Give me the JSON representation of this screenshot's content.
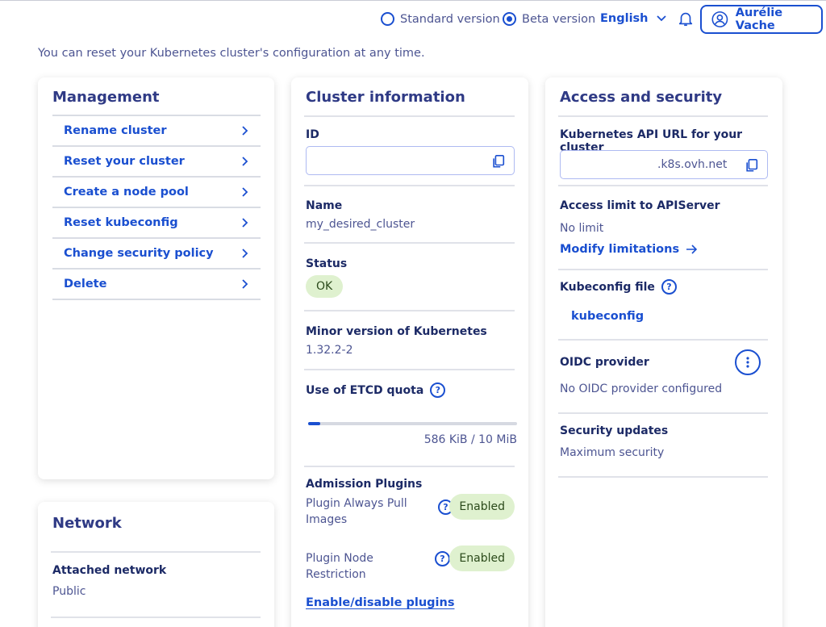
{
  "topbar": {
    "standard_label": "Standard version",
    "beta_label": "Beta version",
    "language": "English",
    "user_name": "Aurélie Vache"
  },
  "intro_text": "You can reset your Kubernetes cluster's configuration at any time.",
  "management": {
    "title": "Management",
    "items": [
      {
        "label": "Rename cluster"
      },
      {
        "label": "Reset your cluster"
      },
      {
        "label": "Create a node pool"
      },
      {
        "label": "Reset kubeconfig"
      },
      {
        "label": "Change security policy"
      },
      {
        "label": "Delete"
      }
    ]
  },
  "network": {
    "title": "Network",
    "attached_label": "Attached network",
    "attached_value": "Public"
  },
  "cluster": {
    "title": "Cluster information",
    "id_label": "ID",
    "id_value": "",
    "name_label": "Name",
    "name_value": "my_desired_cluster",
    "status_label": "Status",
    "status_value": "OK",
    "version_label": "Minor version of Kubernetes",
    "version_value": "1.32.2-2",
    "etcd_label": "Use of ETCD quota",
    "etcd_usage_text": "586 KiB / 10 MiB",
    "etcd_fraction": 0.057,
    "admission_label": "Admission Plugins",
    "plugins": [
      {
        "name_line1": "Plugin Always Pull",
        "name_line2": "Images",
        "status": "Enabled"
      },
      {
        "name_line1": "Plugin Node",
        "name_line2": "Restriction",
        "status": "Enabled"
      }
    ],
    "plugins_link": "Enable/disable plugins"
  },
  "access": {
    "title": "Access and security",
    "api_label": "Kubernetes API URL for your cluster",
    "api_value": ".k8s.ovh.net",
    "limit_label": "Access limit to APIServer",
    "limit_value": "No limit",
    "modify_link": "Modify limitations",
    "kubeconfig_label": "Kubeconfig file",
    "kubeconfig_link": "kubeconfig",
    "oidc_label": "OIDC provider",
    "oidc_value": "No OIDC provider configured",
    "updates_label": "Security updates",
    "updates_value": "Maximum security"
  },
  "colors": {
    "accent": "#1a4fd0",
    "text": "#4d5592",
    "heading": "#2f3a85",
    "badge_bg": "#dff1cf"
  }
}
